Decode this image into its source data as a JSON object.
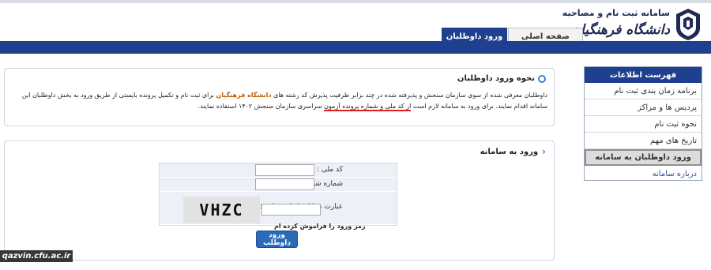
{
  "header": {
    "title": "سامانه ثبت نام و مصاحبه",
    "subtitle": "دانشگاه فرهنگیان",
    "tabs": [
      {
        "label": "صفحه اصلی"
      },
      {
        "label": "ورود داوطلبان"
      }
    ]
  },
  "sidebar": {
    "heading": "فهرست اطلاعات",
    "items": [
      {
        "label": "برنامه زمان بندی ثبت نام"
      },
      {
        "label": "پردیس ها و مراکز"
      },
      {
        "label": "نحوه ثبت نام"
      },
      {
        "label": "تاریخ های مهم"
      },
      {
        "label": "ورود داوطلبان به سامانه"
      },
      {
        "label": "درباره سامانه"
      }
    ]
  },
  "info": {
    "title": "نحوه ورود داوطلبان",
    "text_1": "داوطلبان معرفی شده از سوی سازمان سنجش و پذیرفته شده در چند برابر ظرفیت پذیرش کد رشته های",
    "highlight": "دانشگاه فرهنگیان",
    "text_2": "برای ثبت نام و تکمیل پرونده بایستی از طریق ورود به بخش داوطلبان این سامانه اقدام نمایند. برای ورود به سامانه لازم است",
    "underlined": "از کد ملی و شماره پرونده آزمون",
    "text_3": "سراسری سازمان سنجش ۱۴۰۲ استفاده نمایند."
  },
  "login": {
    "title": "ورود به سامانه",
    "national_code_label": "کد ملی :",
    "national_code_value": "",
    "id_number_label": "شماره شناسنامه:",
    "id_number_value": "",
    "captcha_label": "عبارت مقابل را وارد نمایید :",
    "captcha_text": "VHZC",
    "captcha_value": "",
    "forgot_label": "رمز ورود را فراموش کرده ام",
    "submit_label": "ورود داوطلب"
  },
  "watermark": "qazvin.cfu.ac.ir",
  "colors": {
    "brand_blue": "#1f3f8f",
    "button_blue": "#2a6ab8",
    "highlight_orange": "#c25a00",
    "underline_red": "#e02020"
  }
}
